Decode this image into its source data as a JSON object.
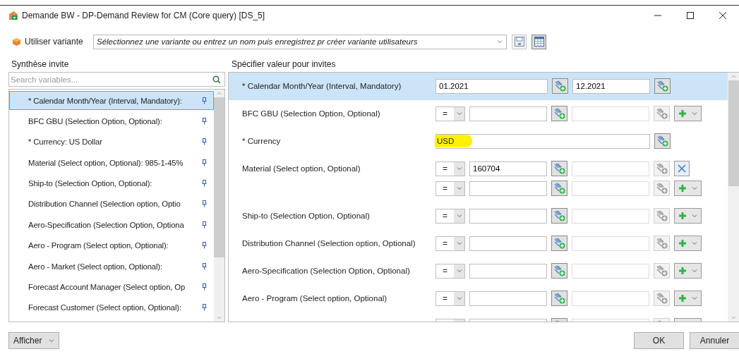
{
  "window": {
    "title": "Demande BW - DP-Demand Review for CM (Core query) [DS_5]"
  },
  "variant": {
    "label": "Utiliser variante",
    "placeholder": "Sélectionnez une variante ou entrez un nom puis enregistrez pr créer variante utilisateurs"
  },
  "summary": {
    "title": "Synthèse invite",
    "search_placeholder": "Search variables...",
    "items": [
      {
        "label": "* Calendar Month/Year (Interval, Mandatory):",
        "selected": true
      },
      {
        "label": "BFC GBU (Selection Option, Optional):",
        "selected": false
      },
      {
        "label": "* Currency: US Dollar",
        "selected": false
      },
      {
        "label": "Material (Select option, Optional): 985-1-45%",
        "selected": false
      },
      {
        "label": "Ship-to (Selection Option, Optional):",
        "selected": false
      },
      {
        "label": "Distribution Channel (Selection option, Optio",
        "selected": false
      },
      {
        "label": "Aero-Specification (Selection Option, Optiona",
        "selected": false
      },
      {
        "label": "Aero - Program (Select option, Optional):",
        "selected": false
      },
      {
        "label": "Aero - Market (Select option, Optional):",
        "selected": false
      },
      {
        "label": "Forecast Account Manager (Select option, Op",
        "selected": false
      },
      {
        "label": "Forecast Customer (Select option, Optional):",
        "selected": false
      }
    ]
  },
  "prompts": {
    "title": "Spécifier valeur pour invites",
    "rows": [
      {
        "kind": "interval",
        "label": "* Calendar Month/Year (Interval, Mandatory)",
        "selected": true,
        "from": "01.2021",
        "to": "12.2021"
      },
      {
        "kind": "select",
        "label": "BFC GBU (Selection Option, Optional)",
        "selected": false,
        "lines": [
          {
            "operator": "=",
            "kind": "add"
          }
        ]
      },
      {
        "kind": "single",
        "label": "* Currency",
        "selected": false,
        "value": "USD",
        "highlighted": true
      },
      {
        "kind": "select",
        "label": "Material (Select option, Optional)",
        "selected": false,
        "lines": [
          {
            "operator": "=",
            "value": "160704",
            "kind": "delete"
          },
          {
            "operator": "=",
            "kind": "add"
          }
        ]
      },
      {
        "kind": "select",
        "label": "Ship-to (Selection Option, Optional)",
        "selected": false,
        "lines": [
          {
            "operator": "=",
            "kind": "add"
          }
        ]
      },
      {
        "kind": "select",
        "label": "Distribution Channel (Selection option, Optional)",
        "selected": false,
        "lines": [
          {
            "operator": "=",
            "kind": "add"
          }
        ]
      },
      {
        "kind": "select",
        "label": "Aero-Specification (Selection Option, Optional)",
        "selected": false,
        "lines": [
          {
            "operator": "=",
            "kind": "add"
          }
        ]
      },
      {
        "kind": "select",
        "label": "Aero - Program (Select option, Optional)",
        "selected": false,
        "lines": [
          {
            "operator": "=",
            "kind": "add"
          }
        ]
      },
      {
        "kind": "select",
        "lines": [
          {
            "kind": "add"
          }
        ]
      }
    ]
  },
  "footer": {
    "display_button": "Afficher",
    "ok": "OK",
    "cancel": "Annuler"
  }
}
